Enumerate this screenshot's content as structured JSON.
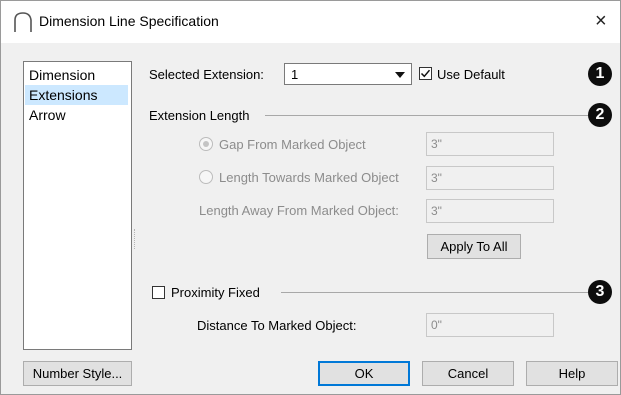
{
  "window": {
    "title": "Dimension Line Specification",
    "close_glyph": "×"
  },
  "sidebar": {
    "items": [
      {
        "label": "Dimension",
        "selected": false
      },
      {
        "label": "Extensions",
        "selected": true
      },
      {
        "label": "Arrow",
        "selected": false
      }
    ]
  },
  "extension_select": {
    "label": "Selected Extension:",
    "value": "1",
    "use_default_label": "Use Default",
    "use_default_checked": true
  },
  "extension_length": {
    "group_label": "Extension Length",
    "gap_label": "Gap From Marked Object",
    "gap_value": "3\"",
    "gap_selected": true,
    "towards_label": "Length Towards Marked Object",
    "towards_value": "3\"",
    "towards_selected": false,
    "away_label": "Length Away From Marked Object:",
    "away_value": "3\"",
    "apply_all_label": "Apply To All"
  },
  "proximity": {
    "label": "Proximity Fixed",
    "checked": false,
    "distance_label": "Distance To Marked Object:",
    "distance_value": "0\""
  },
  "callouts": [
    "1",
    "2",
    "3"
  ],
  "footer": {
    "number_style_label": "Number Style...",
    "ok_label": "OK",
    "cancel_label": "Cancel",
    "help_label": "Help"
  },
  "icons": {
    "title": "arch-dimension-icon",
    "check": "checkmark-icon"
  },
  "colors": {
    "selection": "#cce8ff",
    "default_button_border": "#0078d7",
    "callout_badge": "#0d0d0d"
  }
}
